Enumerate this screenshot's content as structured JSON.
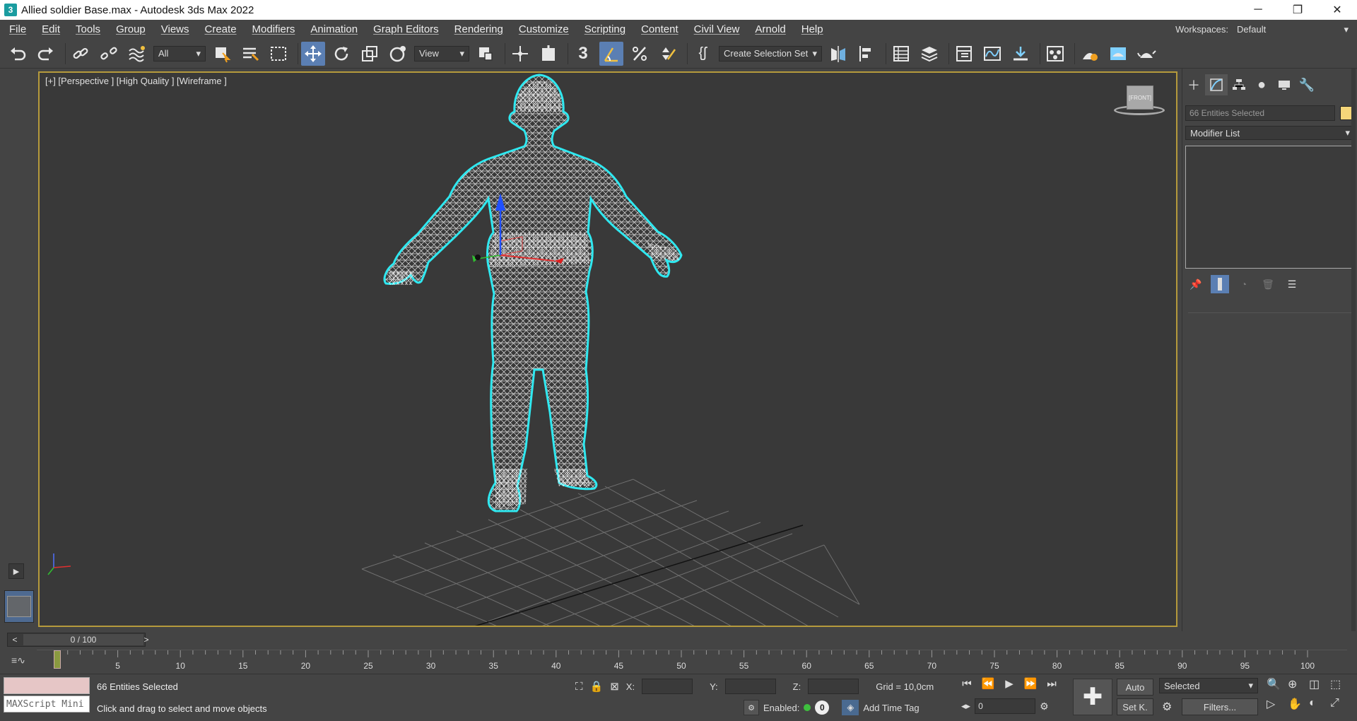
{
  "window": {
    "title": "Allied soldier Base.max - Autodesk 3ds Max 2022",
    "app_icon": "3",
    "minimize": "─",
    "restore": "❐",
    "close": "✕"
  },
  "menu": [
    "File",
    "Edit",
    "Tools",
    "Group",
    "Views",
    "Create",
    "Modifiers",
    "Animation",
    "Graph Editors",
    "Rendering",
    "Customize",
    "Scripting",
    "Content",
    "Civil View",
    "Arnold",
    "Help"
  ],
  "workspace": {
    "label": "Workspaces:",
    "value": "Default"
  },
  "toolbar": {
    "filter_value": "All",
    "ref_coord_value": "View",
    "selection_set_value": "Create Selection Set",
    "snap_value": "3"
  },
  "viewport": {
    "label": "[+] [Perspective ] [High Quality ] [Wireframe ]",
    "viewcube_text": "[FRONT]"
  },
  "command_panel": {
    "selection_name": "66 Entities Selected",
    "modifier_list": "Modifier List",
    "swatch_color": "#f5d67a"
  },
  "timeline": {
    "frame_display": "0 / 100",
    "prev": "<",
    "next": ">",
    "ticks": [
      "5",
      "10",
      "15",
      "20",
      "25",
      "30",
      "35",
      "40",
      "45",
      "50",
      "55",
      "60",
      "65",
      "70",
      "75",
      "80",
      "85",
      "90",
      "95",
      "100"
    ]
  },
  "status": {
    "maxscript": "MAXScript Mini",
    "selected_text": "66 Entities Selected",
    "prompt_text": "Click and drag to select and move objects",
    "x_label": "X:",
    "y_label": "Y:",
    "z_label": "Z:",
    "grid_text": "Grid = 10,0cm",
    "enabled_text": "Enabled:",
    "add_time_tag": "Add Time Tag",
    "auto_button": "Auto",
    "setkey_button": "Set K.",
    "key_filter_value": "Selected",
    "filters_button": "Filters...",
    "frame_value": "0",
    "enabled_count": "0"
  }
}
